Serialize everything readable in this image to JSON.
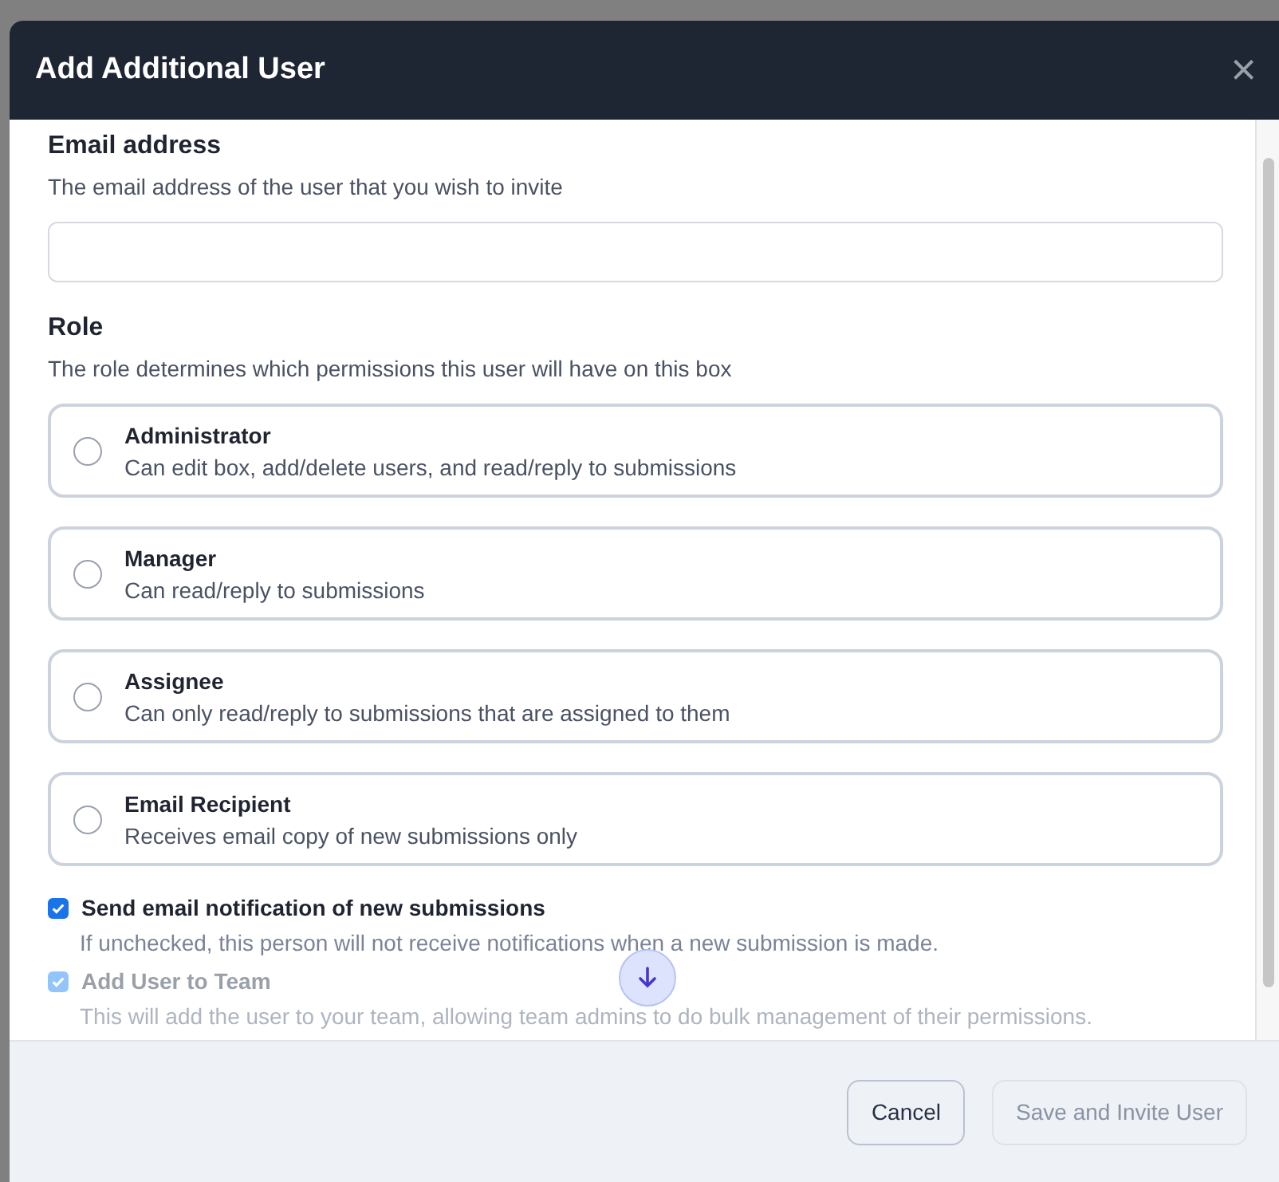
{
  "dialog": {
    "title": "Add Additional User",
    "close_glyph": "×",
    "email": {
      "label": "Email address",
      "help": "The email address of the user that you wish to invite"
    },
    "role": {
      "label": "Role",
      "help": "The role determines which permissions this user will have on this box",
      "options": [
        {
          "title": "Administrator",
          "description": "Can edit box, add/delete users, and read/reply to submissions",
          "selected": false
        },
        {
          "title": "Manager",
          "description": "Can read/reply to submissions",
          "selected": false
        },
        {
          "title": "Assignee",
          "description": "Can only read/reply to submissions that are assigned to them",
          "selected": false
        },
        {
          "title": "Email Recipient",
          "description": "Receives email copy of new submissions only",
          "selected": false
        }
      ]
    },
    "checkboxes": [
      {
        "label": "Send email notification of new submissions",
        "help": "If unchecked, this person will not receive notifications when a new submission is made.",
        "checked": true,
        "disabled": false
      },
      {
        "label": "Add User to Team",
        "help": "This will add the user to your team, allowing team admins to do bulk management of their permissions.",
        "checked": true,
        "disabled": true
      }
    ],
    "buttons": [
      {
        "label": "Cancel",
        "kind": "secondary",
        "disabled": false
      },
      {
        "label": "Save and Invite User",
        "kind": "primary",
        "disabled": true
      }
    ]
  }
}
